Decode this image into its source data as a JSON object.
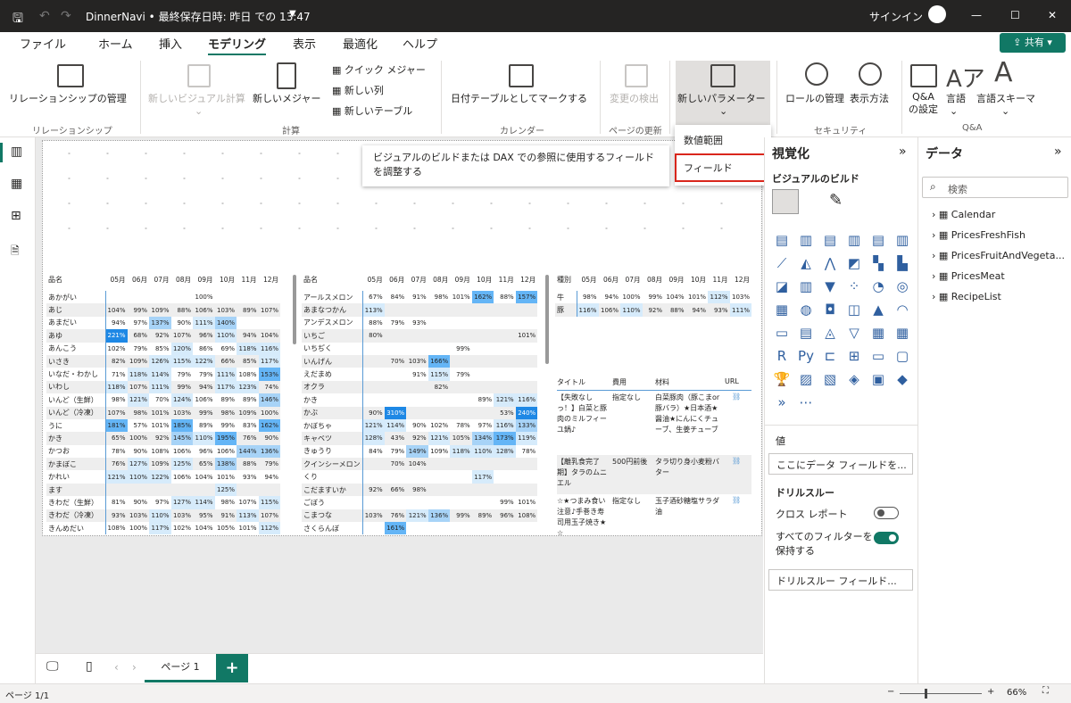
{
  "titlebar": {
    "title": "DinnerNavi • 最終保存日時: 昨日 での 13:47",
    "signin": "サインイン"
  },
  "tabs": [
    "ファイル",
    "ホーム",
    "挿入",
    "モデリング",
    "表示",
    "最適化",
    "ヘルプ"
  ],
  "share": "共有",
  "ribbon": {
    "manage_rel": "リレーションシップの管理",
    "new_visual_calc": "新しいビジュアル計算",
    "new_measure": "新しいメジャー",
    "quick_measure": "クイック メジャー",
    "new_column": "新しい列",
    "new_table": "新しいテーブル",
    "mark_date": "日付テーブルとしてマークする",
    "detect_changes": "変更の検出",
    "new_parameter": "新しいパラメーター",
    "manage_roles": "ロールの管理",
    "view_as": "表示方法",
    "qa_settings": "Q&A\nの設定",
    "language": "言語",
    "linguistic_schema": "言語スキーマ",
    "groups": {
      "rel": "リレーションシップ",
      "calc": "計算",
      "calendar": "カレンダー",
      "page_refresh": "ページの更新",
      "security": "セキュリティ",
      "qa": "Q&A"
    }
  },
  "dropdown": {
    "numeric_range": "数値範囲",
    "fields": "フィールド"
  },
  "tooltip": "ビジュアルのビルドまたは DAX での参照に使用するフィールドを調整する",
  "months": [
    "05月",
    "06月",
    "07月",
    "08月",
    "09月",
    "10月",
    "11月",
    "12月"
  ],
  "table1": {
    "header": "品名",
    "rows": [
      [
        "あかがい",
        "",
        "",
        "",
        "",
        "100%",
        "",
        "",
        ""
      ],
      [
        "あじ",
        "104%",
        "99%",
        "109%",
        "88%",
        "106%",
        "103%",
        "89%",
        "107%"
      ],
      [
        "あまだい",
        "94%",
        "97%",
        "137%",
        "90%",
        "111%",
        "140%",
        "",
        ""
      ],
      [
        "あゆ",
        "221%",
        "68%",
        "92%",
        "107%",
        "96%",
        "110%",
        "94%",
        "104%"
      ],
      [
        "あんこう",
        "102%",
        "79%",
        "85%",
        "120%",
        "86%",
        "69%",
        "118%",
        "116%"
      ],
      [
        "いさき",
        "82%",
        "109%",
        "126%",
        "115%",
        "122%",
        "66%",
        "85%",
        "117%"
      ],
      [
        "いなだ・わかし",
        "71%",
        "118%",
        "114%",
        "79%",
        "79%",
        "111%",
        "108%",
        "153%"
      ],
      [
        "いわし",
        "118%",
        "107%",
        "111%",
        "99%",
        "94%",
        "117%",
        "123%",
        "74%"
      ],
      [
        "いんど（生鮮）",
        "98%",
        "121%",
        "70%",
        "124%",
        "106%",
        "89%",
        "89%",
        "146%"
      ],
      [
        "いんど（冷凍）",
        "107%",
        "98%",
        "101%",
        "103%",
        "99%",
        "98%",
        "109%",
        "100%"
      ],
      [
        "うに",
        "181%",
        "57%",
        "101%",
        "185%",
        "89%",
        "99%",
        "83%",
        "162%"
      ],
      [
        "かき",
        "65%",
        "100%",
        "92%",
        "145%",
        "110%",
        "195%",
        "76%",
        "90%"
      ],
      [
        "かつお",
        "78%",
        "90%",
        "108%",
        "106%",
        "96%",
        "106%",
        "144%",
        "136%"
      ],
      [
        "かまぼこ",
        "76%",
        "127%",
        "109%",
        "125%",
        "65%",
        "138%",
        "88%",
        "79%"
      ],
      [
        "かれい",
        "121%",
        "110%",
        "122%",
        "106%",
        "104%",
        "101%",
        "93%",
        "94%"
      ],
      [
        "ます",
        "",
        "",
        "",
        "",
        "",
        "125%",
        "",
        ""
      ],
      [
        "きわだ（生鮮）",
        "81%",
        "90%",
        "97%",
        "127%",
        "114%",
        "98%",
        "107%",
        "115%"
      ],
      [
        "きわだ（冷凍）",
        "93%",
        "103%",
        "110%",
        "103%",
        "95%",
        "91%",
        "113%",
        "107%"
      ],
      [
        "きんめだい",
        "108%",
        "100%",
        "117%",
        "102%",
        "104%",
        "105%",
        "101%",
        "112%"
      ]
    ]
  },
  "table2": {
    "header": "品名",
    "rows": [
      [
        "アールスメロン",
        "67%",
        "84%",
        "91%",
        "98%",
        "101%",
        "162%",
        "88%",
        "157%"
      ],
      [
        "あまなつかん",
        "113%",
        "",
        "",
        "",
        "",
        "",
        "",
        ""
      ],
      [
        "アンデスメロン",
        "88%",
        "79%",
        "93%",
        "",
        "",
        "",
        "",
        ""
      ],
      [
        "いちご",
        "80%",
        "",
        "",
        "",
        "",
        "",
        "",
        "101%"
      ],
      [
        "いちぢく",
        "",
        "",
        "",
        "",
        "99%",
        "",
        "",
        ""
      ],
      [
        "いんげん",
        "",
        "70%",
        "103%",
        "166%",
        "",
        "",
        "",
        ""
      ],
      [
        "えだまめ",
        "",
        "",
        "91%",
        "115%",
        "79%",
        "",
        "",
        ""
      ],
      [
        "オクラ",
        "",
        "",
        "",
        "82%",
        "",
        "",
        "",
        ""
      ],
      [
        "かき",
        "",
        "",
        "",
        "",
        "",
        "89%",
        "121%",
        "116%"
      ],
      [
        "かぶ",
        "90%",
        "310%",
        "",
        "",
        "",
        "",
        "53%",
        "240%"
      ],
      [
        "かぼちゃ",
        "121%",
        "114%",
        "90%",
        "102%",
        "78%",
        "97%",
        "116%",
        "133%"
      ],
      [
        "キャベツ",
        "128%",
        "43%",
        "92%",
        "121%",
        "105%",
        "134%",
        "173%",
        "119%"
      ],
      [
        "きゅうり",
        "84%",
        "79%",
        "149%",
        "109%",
        "118%",
        "110%",
        "128%",
        "78%"
      ],
      [
        "クインシーメロン",
        "",
        "70%",
        "104%",
        "",
        "",
        "",
        "",
        ""
      ],
      [
        "くり",
        "",
        "",
        "",
        "",
        "",
        "117%",
        "",
        ""
      ],
      [
        "こだますいか",
        "92%",
        "66%",
        "98%",
        "",
        "",
        "",
        "",
        ""
      ],
      [
        "ごぼう",
        "",
        "",
        "",
        "",
        "",
        "",
        "99%",
        "101%"
      ],
      [
        "こまつな",
        "103%",
        "76%",
        "121%",
        "136%",
        "99%",
        "89%",
        "96%",
        "108%"
      ],
      [
        "さくらんぼ",
        "",
        "161%",
        "",
        "",
        "",
        "",
        "",
        ""
      ]
    ]
  },
  "table3": {
    "header": "種別",
    "rows": [
      [
        "牛",
        "98%",
        "94%",
        "100%",
        "99%",
        "104%",
        "101%",
        "112%",
        "103%"
      ],
      [
        "豚",
        "116%",
        "106%",
        "110%",
        "92%",
        "88%",
        "94%",
        "93%",
        "111%"
      ]
    ]
  },
  "recipes": {
    "headers": [
      "タイトル",
      "費用",
      "材料",
      "URL"
    ],
    "rows": [
      [
        "【失敗なしっ！】白菜と豚肉のミルフィーユ鍋♪",
        "指定なし",
        "白菜豚肉（豚こまor豚バラ）★日本酒★醤油★にんにくチューブ、生姜チューブ"
      ],
      [
        "【離乳食完了期】タラのムニエル",
        "500円前後",
        "タラ切り身小麦粉バター"
      ],
      [
        "☆★つまみ食い注意♪手巻き寿司用玉子焼き★☆",
        "指定なし",
        "玉子酒砂糖塩サラダ油"
      ]
    ]
  },
  "viz": {
    "title": "視覚化",
    "build": "ビジュアルのビルド",
    "values": "値",
    "add_field": "ここにデータ フィールドを...",
    "drill": "ドリルスルー",
    "cross_report": "クロス レポート",
    "keep_filters": "すべてのフィルターを保持する",
    "drill_field": "ドリルスルー フィールド...",
    "more": "..."
  },
  "data_pane": {
    "title": "データ",
    "search": "検索",
    "tables": [
      "Calendar",
      "PricesFreshFish",
      "PricesFruitAndVegeta...",
      "PricesMeat",
      "RecipeList"
    ]
  },
  "page_tab": "ページ 1",
  "status": {
    "page": "ページ 1/1",
    "zoom": "66%"
  }
}
